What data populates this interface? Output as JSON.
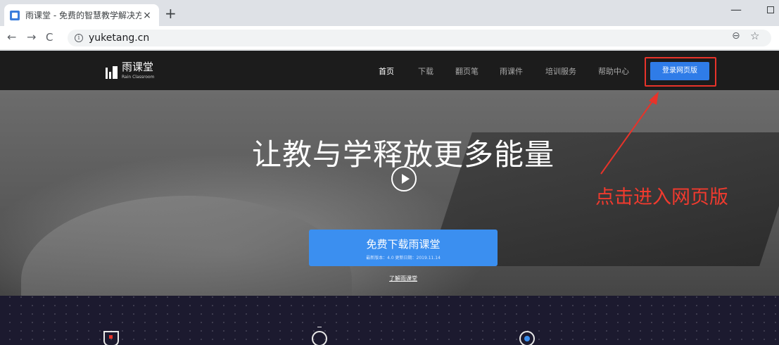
{
  "browser": {
    "tab_title": "雨课堂 - 免费的智慧教学解决方",
    "tab_close": "×",
    "new_tab": "+",
    "back": "←",
    "forward": "→",
    "reload": "C",
    "info_glyph": "i",
    "url": "yuketang.cn",
    "zoom_glyph": "⊖",
    "star_glyph": "☆",
    "minimize": "—"
  },
  "site": {
    "logo_name": "雨课堂",
    "logo_tagline": "Rain Classroom",
    "nav": [
      {
        "label": "首页",
        "active": true
      },
      {
        "label": "下载",
        "active": false
      },
      {
        "label": "翻页笔",
        "active": false
      },
      {
        "label": "雨课件",
        "active": false
      },
      {
        "label": "培训服务",
        "active": false
      },
      {
        "label": "帮助中心",
        "active": false
      }
    ],
    "login_label": "登录网页版"
  },
  "hero": {
    "title": "让教与学释放更多能量",
    "download_label": "免费下载雨课堂",
    "download_meta": "最新版本：4.0   更新日期：2019.11.14",
    "learn_more": "了解雨课堂"
  },
  "annotation": {
    "text": "点击进入网页版",
    "color": "#f03a2e"
  },
  "colors": {
    "accent": "#3b8ff0",
    "login": "#2f7ce8",
    "nav_bg": "#1c1c1c",
    "highlight": "#e8332a"
  }
}
